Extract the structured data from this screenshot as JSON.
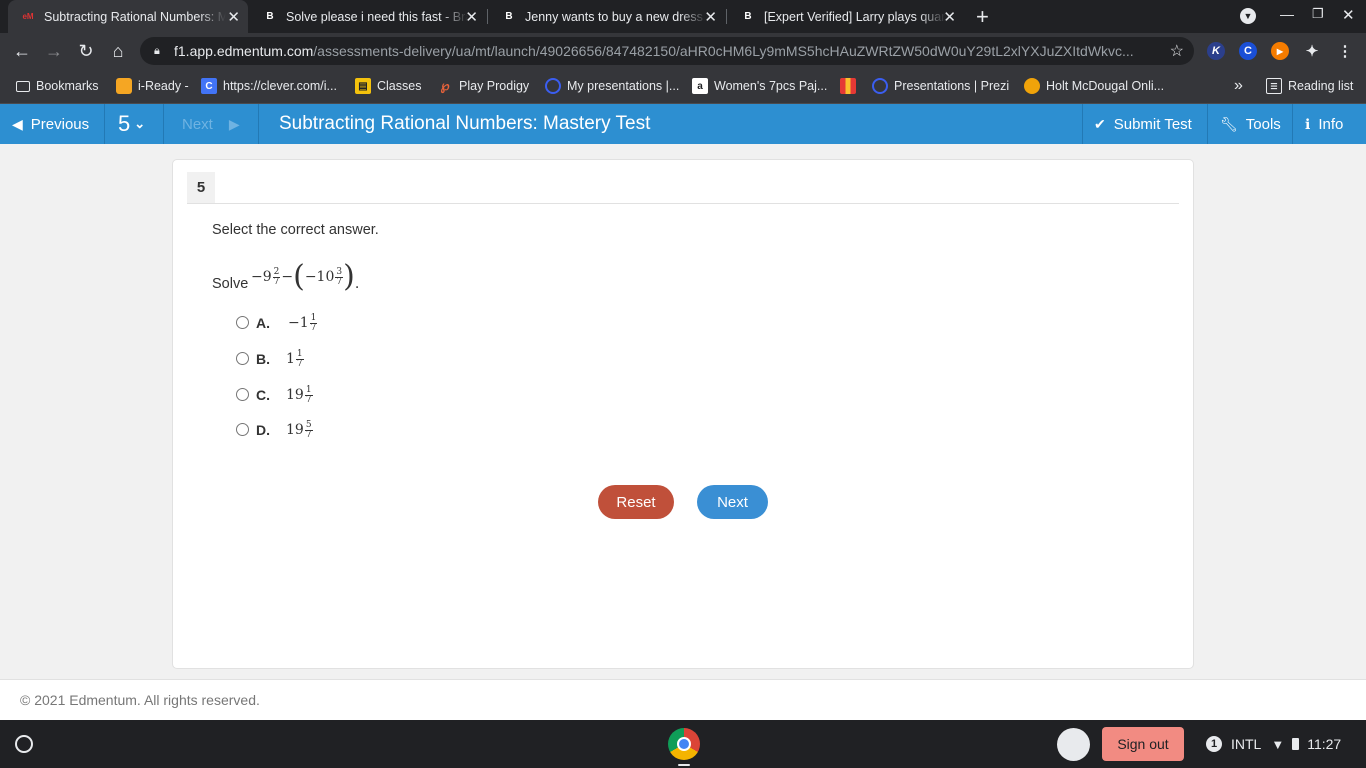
{
  "browser": {
    "tabs": [
      {
        "title": "Subtracting Rational Numbers: M",
        "fav": "eM",
        "active": true
      },
      {
        "title": "Solve please i need this fast - Bra",
        "fav": "B",
        "active": false
      },
      {
        "title": "Jenny wants to buy a new dress",
        "fav": "B",
        "active": false
      },
      {
        "title": "[Expert Verified] Larry plays quar",
        "fav": "B",
        "active": false
      }
    ],
    "new_tab": "+",
    "url_host": "f1.app.edmentum.com",
    "url_path": "/assessments-delivery/ua/mt/launch/49026656/847482150/aHR0cHM6Ly9mMS5hcHAuZWRtZW50dW0uY29tL2xlYXJuZXItdWkvc...",
    "extensions": [
      "K",
      "C",
      "▶",
      "✦"
    ],
    "bookmarks": [
      {
        "label": "Bookmarks",
        "icon": "folder-icon",
        "color": "#e8eaed"
      },
      {
        "label": "i-Ready -",
        "icon": "iready-icon",
        "color": "#f5a623"
      },
      {
        "label": "https://clever.com/i...",
        "icon": "clever-icon",
        "color": "#4274f6"
      },
      {
        "label": "Classes",
        "icon": "classes-icon",
        "color": "#f4c20d"
      },
      {
        "label": "Play Prodigy",
        "icon": "prodigy-icon",
        "color": "#e8623a"
      },
      {
        "label": "My presentations |...",
        "icon": "globe-icon",
        "color": "#3b5ef0"
      },
      {
        "label": "Women's 7pcs Paj...",
        "icon": "amazon-icon",
        "color": "#ffffff"
      },
      {
        "label": "",
        "icon": "mcd-icon",
        "color": "#e53935"
      },
      {
        "label": "Presentations | Prezi",
        "icon": "globe-icon",
        "color": "#3b5ef0"
      },
      {
        "label": "Holt McDougal Onli...",
        "icon": "holt-icon",
        "color": "#f0a30a"
      }
    ],
    "more_bookmarks": "»",
    "reading_list": "Reading list"
  },
  "app": {
    "previous_label": "Previous",
    "question_selector": "5",
    "next_nav_label": "Next",
    "title": "Subtracting Rational Numbers: Mastery Test",
    "submit_label": "Submit Test",
    "tools_label": "Tools",
    "info_label": "Info"
  },
  "question": {
    "number": "5",
    "instruction": "Select the correct answer.",
    "prompt_word": "Solve",
    "expression": {
      "a_whole": "−9",
      "a_num": "2",
      "a_den": "7",
      "op": "−",
      "b_whole": "−10",
      "b_num": "3",
      "b_den": "7",
      "end": "."
    },
    "options": [
      {
        "letter": "A.",
        "whole": "−1",
        "num": "1",
        "den": "7"
      },
      {
        "letter": "B.",
        "whole": "1",
        "num": "1",
        "den": "7"
      },
      {
        "letter": "C.",
        "whole": "19",
        "num": "1",
        "den": "7"
      },
      {
        "letter": "D.",
        "whole": "19",
        "num": "5",
        "den": "7"
      }
    ],
    "reset_label": "Reset",
    "next_label": "Next"
  },
  "footer": {
    "copyright": "© 2021 Edmentum. All rights reserved."
  },
  "shelf": {
    "sign_out": "Sign out",
    "notification_count": "1",
    "input_method": "INTL",
    "time": "11:27"
  },
  "colors": {
    "app_bar": "#2d8fd1",
    "reset_button": "#c0503a",
    "next_button": "#3a8fd4",
    "sign_out": "#f28b82"
  }
}
